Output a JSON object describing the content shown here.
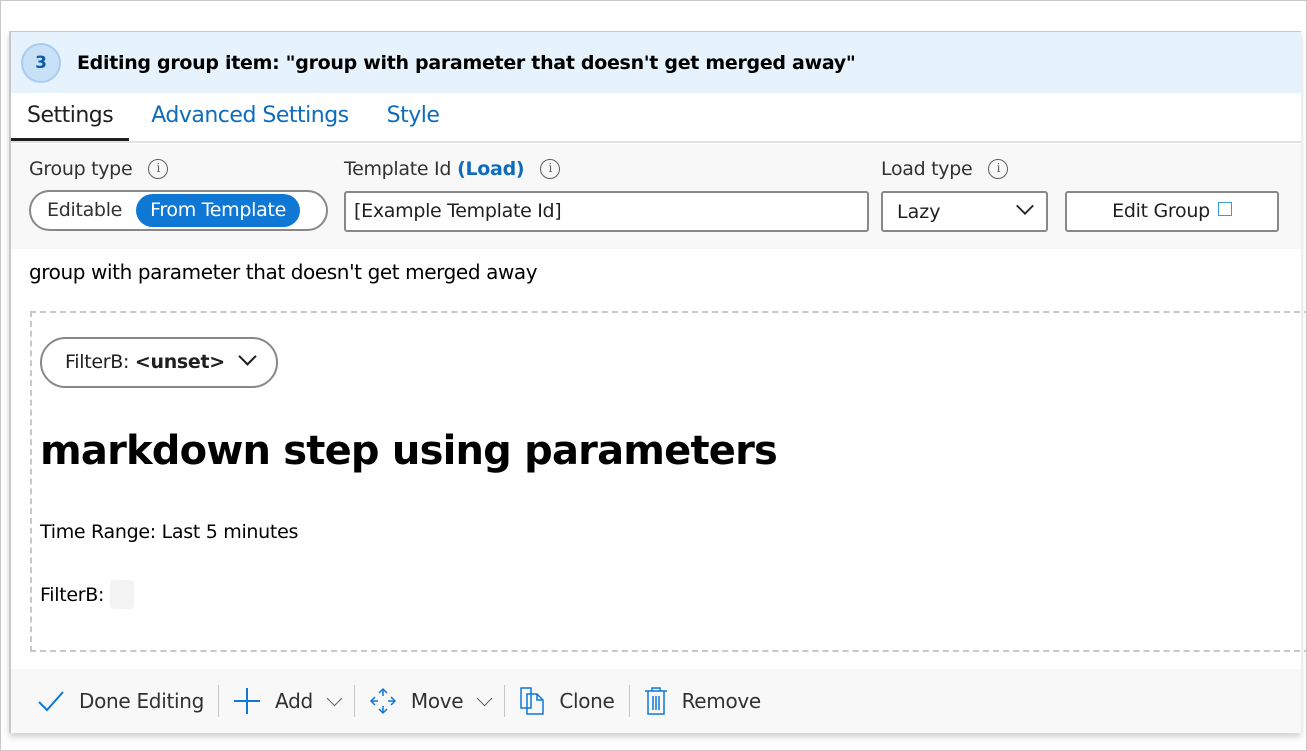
{
  "header": {
    "step_number": "3",
    "title": "Editing group item: \"group with parameter that doesn't get merged away\""
  },
  "tabs": [
    {
      "label": "Settings",
      "active": true
    },
    {
      "label": "Advanced Settings"
    },
    {
      "label": "Style"
    }
  ],
  "settings": {
    "group_type": {
      "label": "Group type",
      "options": [
        "Editable",
        "From Template"
      ],
      "selected": "From Template"
    },
    "template_id": {
      "label": "Template Id",
      "load_link": "(Load)",
      "value": "[Example Template Id]"
    },
    "load_type": {
      "label": "Load type",
      "value": "Lazy"
    },
    "edit_group_label": "Edit Group"
  },
  "group_name": "group with parameter that doesn't get merged away",
  "content": {
    "filter": {
      "name": "FilterB:",
      "value": "<unset>"
    },
    "heading": "markdown step using parameters",
    "time_range": "Time Range: Last 5 minutes",
    "filterb_label": "FilterB:"
  },
  "footer": {
    "done": "Done Editing",
    "add": "Add",
    "move": "Move",
    "clone": "Clone",
    "remove": "Remove"
  },
  "colors": {
    "accent": "#0f78d4",
    "header_bg": "#e6f3fd"
  }
}
